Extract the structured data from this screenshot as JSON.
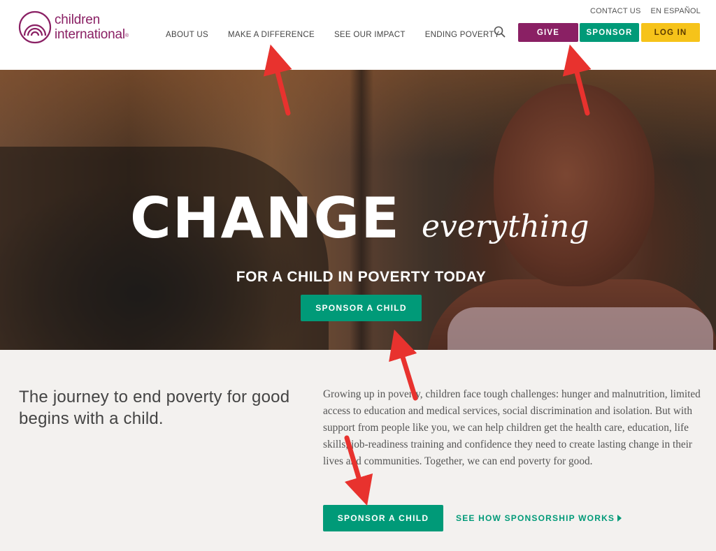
{
  "header": {
    "logo_line1": "children",
    "logo_line2": "international",
    "logo_mark": "®",
    "util": {
      "contact": "CONTACT US",
      "spanish": "EN ESPAÑOL"
    },
    "nav": [
      "ABOUT US",
      "MAKE A DIFFERENCE",
      "SEE OUR IMPACT",
      "ENDING POVERTY"
    ],
    "search_icon": "search-icon",
    "buttons": {
      "give": "GIVE",
      "sponsor": "SPONSOR",
      "login": "LOG IN"
    }
  },
  "hero": {
    "title_bold": "CHANGE",
    "title_script": "everything",
    "subtitle": "FOR A CHILD IN POVERTY TODAY",
    "cta": "SPONSOR A CHILD"
  },
  "intro": {
    "tagline": "The journey to end poverty for good begins with a child.",
    "body": "Growing up in poverty, children face tough challenges: hunger and malnutrition, limited access to education and medical services, social discrimination and isolation. But with support from people like you, we can help children get the health care, education, life skills, job-readiness training and confidence they need to create lasting change in their lives and communities. Together, we can end poverty for good.",
    "cta": "SPONSOR A CHILD",
    "link": "SEE HOW SPONSORSHIP WORKS"
  },
  "colors": {
    "brand_purple": "#8a2064",
    "brand_green": "#009a78",
    "brand_yellow": "#f6c31a",
    "annotation_red": "#e8322e"
  }
}
